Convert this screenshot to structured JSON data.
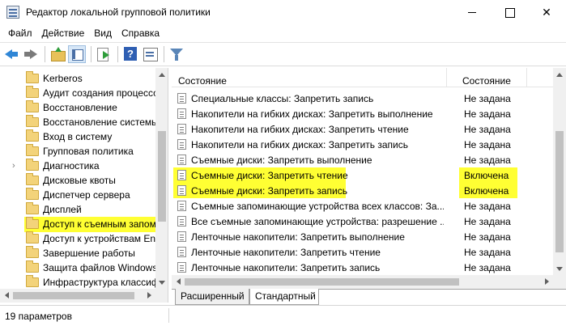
{
  "window": {
    "title": "Редактор локальной групповой политики",
    "minimize_glyph": "",
    "maximize_glyph": "",
    "close_glyph": "✕"
  },
  "menu": [
    "Файл",
    "Действие",
    "Вид",
    "Справка"
  ],
  "toolbar": {
    "icons": [
      "back-arrow-icon",
      "forward-arrow-icon",
      "folder-up-icon",
      "show-hide-tree-icon",
      "export-list-icon",
      "help-icon",
      "properties-icon",
      "filter-icon"
    ]
  },
  "tree": {
    "items": [
      {
        "label": "Kerberos",
        "expander": ""
      },
      {
        "label": "Аудит создания процессов",
        "expander": ""
      },
      {
        "label": "Восстановление",
        "expander": ""
      },
      {
        "label": "Восстановление системы",
        "expander": ""
      },
      {
        "label": "Вход в систему",
        "expander": ""
      },
      {
        "label": "Групповая политика",
        "expander": ""
      },
      {
        "label": "Диагностика",
        "expander": "›"
      },
      {
        "label": "Дисковые квоты",
        "expander": ""
      },
      {
        "label": "Диспетчер сервера",
        "expander": ""
      },
      {
        "label": "Дисплей",
        "expander": ""
      },
      {
        "label": "Доступ к съемным запоминающим",
        "expander": "",
        "selected": true
      },
      {
        "label": "Доступ к устройствам Enhanced",
        "expander": ""
      },
      {
        "label": "Завершение работы",
        "expander": ""
      },
      {
        "label": "Защита файлов Windows",
        "expander": ""
      },
      {
        "label": "Инфраструктура классификации",
        "expander": ""
      }
    ]
  },
  "table": {
    "headers": {
      "setting": "Состояние",
      "state": "Состояние"
    },
    "rows": [
      {
        "setting": "Специальные классы: Запретить запись",
        "state": "Не задана"
      },
      {
        "setting": "Накопители на гибких дисках: Запретить выполнение",
        "state": "Не задана"
      },
      {
        "setting": "Накопители на гибких дисках: Запретить чтение",
        "state": "Не задана"
      },
      {
        "setting": "Накопители на гибких дисках: Запретить запись",
        "state": "Не задана"
      },
      {
        "setting": "Съемные диски: Запретить выполнение",
        "state": "Не задана"
      },
      {
        "setting": "Съемные диски: Запретить чтение",
        "state": "Включена",
        "highlighted": true
      },
      {
        "setting": "Съемные диски: Запретить запись",
        "state": "Включена",
        "highlighted": true
      },
      {
        "setting": "Съемные запоминающие устройства всех классов: За...",
        "state": "Не задана"
      },
      {
        "setting": "Все съемные запоминающие устройства: разрешение ...",
        "state": "Не задана"
      },
      {
        "setting": "Ленточные накопители: Запретить выполнение",
        "state": "Не задана"
      },
      {
        "setting": "Ленточные накопители: Запретить чтение",
        "state": "Не задана"
      },
      {
        "setting": "Ленточные накопители: Запретить запись",
        "state": "Не задана"
      }
    ]
  },
  "tabs": {
    "extended": "Расширенный",
    "standard": "Стандартный",
    "active": "standard"
  },
  "status": {
    "text": "19 параметров"
  },
  "colors": {
    "highlight": "#ffff33",
    "accent": "#2f86d6"
  }
}
